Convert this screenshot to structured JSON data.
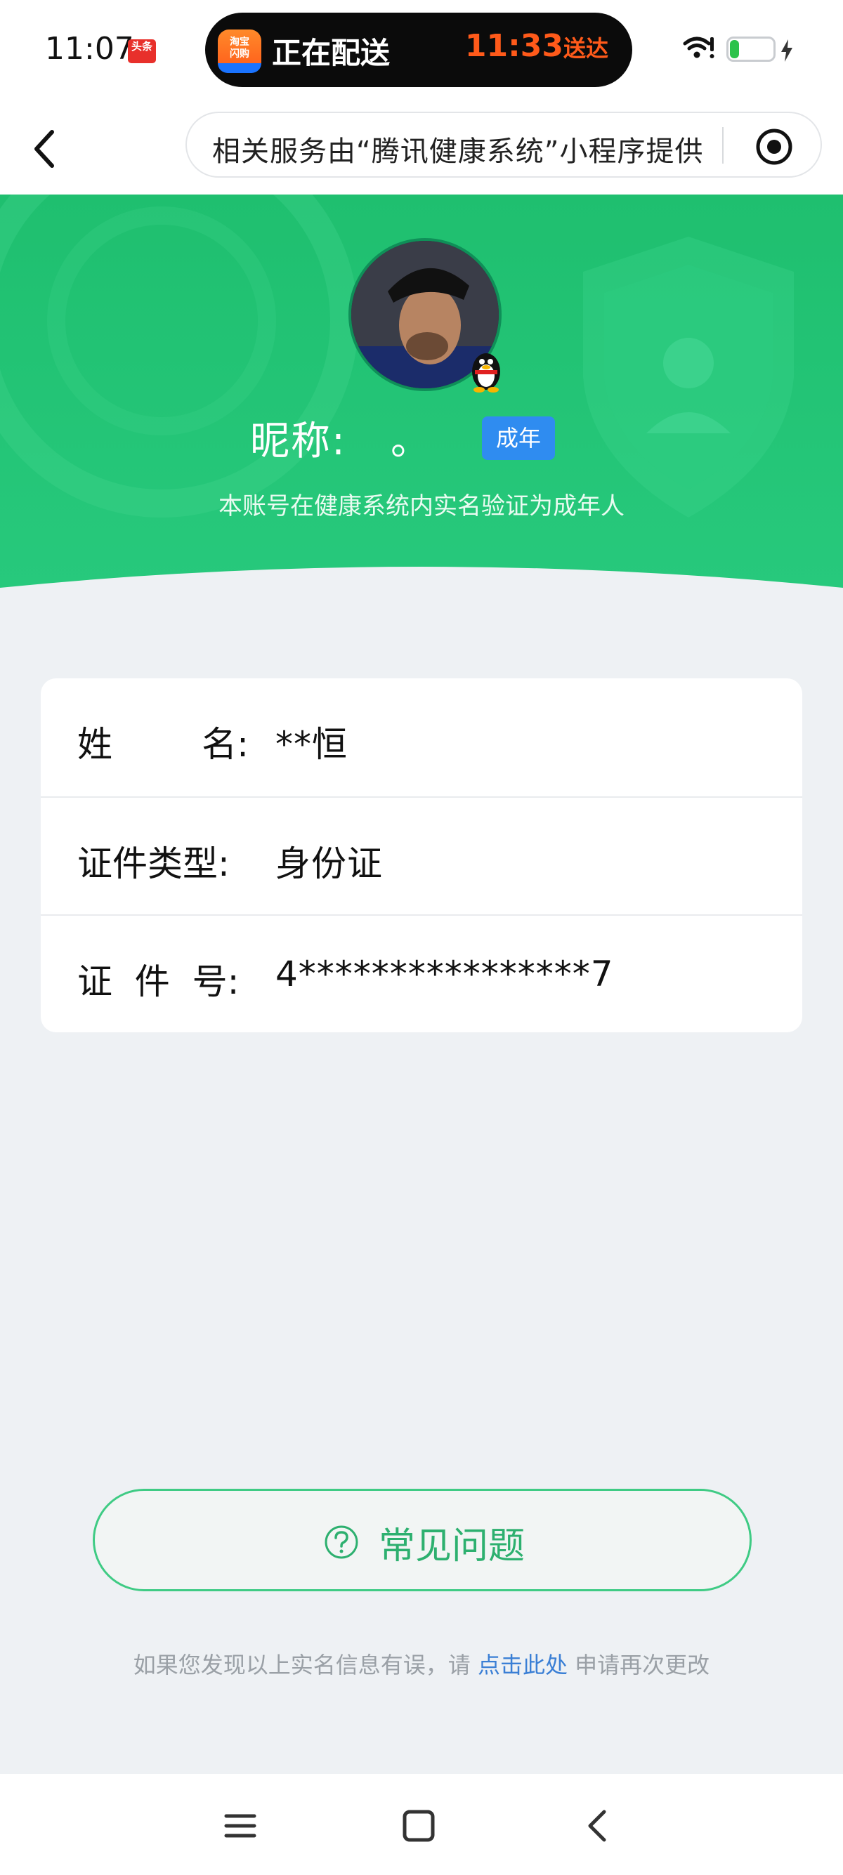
{
  "status_bar": {
    "time": "11:07",
    "toutiao_badge": "头条",
    "island": {
      "app_icon_text": "淘宝闪购",
      "title": "正在配送",
      "eta_time": "11:33",
      "eta_suffix": "送达"
    },
    "battery_level": "22",
    "icons": [
      "wifi-icon",
      "battery-icon",
      "charging-bolt-icon"
    ]
  },
  "nav_bar": {
    "capsule_text": "相关服务由“腾讯健康系统”小程序提供",
    "icons": [
      "back-chevron-icon",
      "record-target-icon"
    ]
  },
  "profile": {
    "nickname_label": "昵称:",
    "nickname_value": "。",
    "badge": "成年",
    "subtitle": "本账号在健康系统内实名验证为成年人"
  },
  "info_rows": [
    {
      "label": "姓        名:",
      "value": "**恒"
    },
    {
      "label": "证件类型:",
      "value": "身份证"
    },
    {
      "label": "证  件  号:",
      "value": "4****************7"
    }
  ],
  "faq": {
    "label": "常见问题",
    "icon": "question-circle-icon"
  },
  "footer": {
    "prefix": "如果您发现以上实名信息有误，请",
    "link": "点击此处",
    "suffix": "申请再次更改"
  },
  "colors": {
    "hero_green": "#22c274",
    "faq_green": "#2db06f",
    "badge_blue": "#2f8cf0",
    "link_blue": "#3a7fd5",
    "page_bg": "#eef1f4"
  }
}
